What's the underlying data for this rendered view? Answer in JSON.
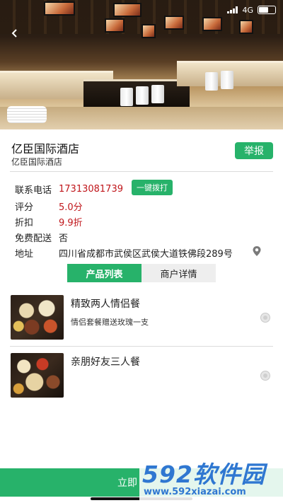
{
  "status_bar": {
    "network": "4G",
    "battery": "58"
  },
  "store": {
    "name": "亿臣国际酒店",
    "subtitle": "亿臣国际酒店",
    "report_label": "举报"
  },
  "info": {
    "phone_label": "联系电话",
    "phone_value": "17313081739",
    "call_button": "一键拨打",
    "rating_label": "评分",
    "rating_value": "5.0分",
    "discount_label": "折扣",
    "discount_value": "9.9折",
    "delivery_label": "免费配送",
    "delivery_value": "否",
    "address_label": "地址",
    "address_value": "四川省成都市武侯区武侯大道铁佛段289号"
  },
  "tabs": [
    {
      "label": "产品列表",
      "active": true
    },
    {
      "label": "商户详情",
      "active": false
    }
  ],
  "products": [
    {
      "name": "精致两人情侣餐",
      "description": "情侣套餐赠送玫瑰一支"
    },
    {
      "name": "亲朋好友三人餐",
      "description": ""
    }
  ],
  "bottom_button": "立即",
  "watermark": {
    "logo": "592软件园",
    "url": "www.592xiazai.com"
  },
  "colors": {
    "accent": "#27b26a",
    "price_red": "#c0161b",
    "watermark_blue": "#2f77d1"
  },
  "icons": [
    "back-arrow-icon",
    "location-pin-icon",
    "signal-icon",
    "battery-icon"
  ]
}
